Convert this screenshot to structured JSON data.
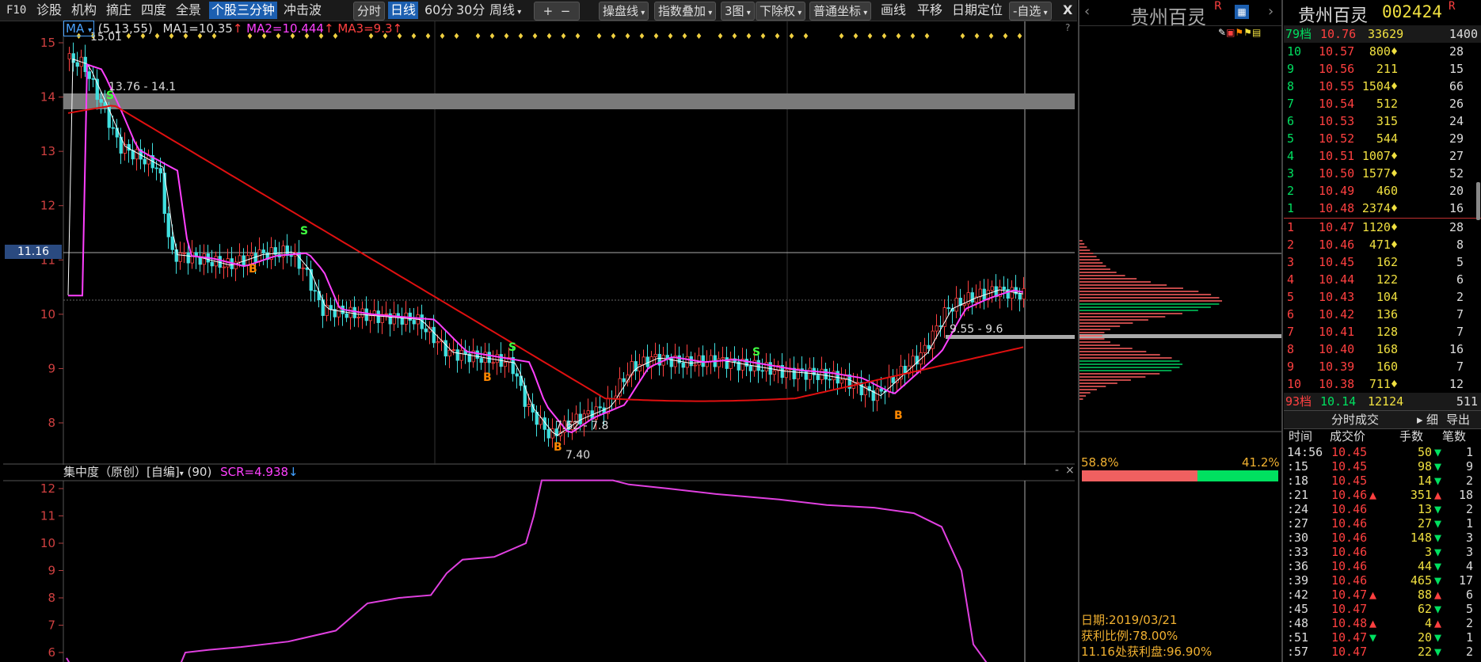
{
  "toolbar": {
    "items": [
      "F10",
      "诊股",
      "机构",
      "摘庄",
      "四度",
      "全景",
      "个股三分钟",
      "冲击波"
    ],
    "period_buttons": [
      "分时",
      "日线",
      "60分",
      "30分",
      "周线"
    ],
    "zoom_buttons": [
      "+",
      "−"
    ],
    "tools": [
      "操盘线",
      "指数叠加",
      "3图",
      "下除权",
      "普通坐标",
      "画线",
      "平移",
      "日期定位",
      "自选"
    ],
    "close_glyph": "X"
  },
  "main_chart": {
    "indicator_selector": "MA",
    "ma_params": "(5,13,55)",
    "ma1": "MA1=10.35",
    "ma2": "MA2=10.444",
    "ma3": "MA3=9.3",
    "price_axis": [
      "15",
      "14",
      "13",
      "12",
      "11",
      "10",
      "9",
      "8"
    ],
    "crosshair_price": "11.16",
    "annotations": {
      "high": "15.01",
      "zone1": "13.76 - 14.1",
      "zone2": "9.55 - 9.6",
      "zone3": "7.62 - 7.8",
      "low": "7.40"
    },
    "signal_labels": {
      "buy": "B",
      "sell": "S"
    },
    "help": "?"
  },
  "indicator_chart": {
    "title": "集中度（原创）[自编]",
    "param": "(90)",
    "value": "SCR=4.938",
    "axis": [
      "12",
      "11",
      "10",
      "9",
      "8",
      "7",
      "6"
    ],
    "minimize": "-",
    "close": "×"
  },
  "chip_panel": {
    "stock_name": "贵州百灵",
    "r_mark": "R",
    "profit_left": "58.8%",
    "profit_right": "41.2%",
    "date": "日期:2019/03/21",
    "profit_ratio": "获利比例:78.00%",
    "profit_at": "11.16处获利盘:96.90%"
  },
  "quote_panel": {
    "stock_name": "贵州百灵",
    "stock_code": "002424",
    "r_mark": "R",
    "ask_header": {
      "label": "79档",
      "price": "10.76",
      "vol": "33629",
      "count": "1400"
    },
    "asks": [
      {
        "lvl": "10",
        "price": "10.57",
        "vol": "800",
        "mark": "♦",
        "cnt": "28"
      },
      {
        "lvl": "9",
        "price": "10.56",
        "vol": "211",
        "mark": "",
        "cnt": "15"
      },
      {
        "lvl": "8",
        "price": "10.55",
        "vol": "1504",
        "mark": "♦",
        "cnt": "66"
      },
      {
        "lvl": "7",
        "price": "10.54",
        "vol": "512",
        "mark": "",
        "cnt": "26"
      },
      {
        "lvl": "6",
        "price": "10.53",
        "vol": "315",
        "mark": "",
        "cnt": "24"
      },
      {
        "lvl": "5",
        "price": "10.52",
        "vol": "544",
        "mark": "",
        "cnt": "29"
      },
      {
        "lvl": "4",
        "price": "10.51",
        "vol": "1007",
        "mark": "♦",
        "cnt": "27"
      },
      {
        "lvl": "3",
        "price": "10.50",
        "vol": "1577",
        "mark": "♦",
        "cnt": "52"
      },
      {
        "lvl": "2",
        "price": "10.49",
        "vol": "460",
        "mark": "",
        "cnt": "20"
      },
      {
        "lvl": "1",
        "price": "10.48",
        "vol": "2374",
        "mark": "♦",
        "cnt": "16"
      }
    ],
    "bids": [
      {
        "lvl": "1",
        "price": "10.47",
        "vol": "1120",
        "mark": "♦",
        "cnt": "28"
      },
      {
        "lvl": "2",
        "price": "10.46",
        "vol": "471",
        "mark": "♦",
        "cnt": "8"
      },
      {
        "lvl": "3",
        "price": "10.45",
        "vol": "162",
        "mark": "",
        "cnt": "5"
      },
      {
        "lvl": "4",
        "price": "10.44",
        "vol": "122",
        "mark": "",
        "cnt": "6"
      },
      {
        "lvl": "5",
        "price": "10.43",
        "vol": "104",
        "mark": "",
        "cnt": "2"
      },
      {
        "lvl": "6",
        "price": "10.42",
        "vol": "136",
        "mark": "",
        "cnt": "7"
      },
      {
        "lvl": "7",
        "price": "10.41",
        "vol": "128",
        "mark": "",
        "cnt": "7"
      },
      {
        "lvl": "8",
        "price": "10.40",
        "vol": "168",
        "mark": "",
        "cnt": "16"
      },
      {
        "lvl": "9",
        "price": "10.39",
        "vol": "160",
        "mark": "",
        "cnt": "7"
      },
      {
        "lvl": "10",
        "price": "10.38",
        "vol": "711",
        "mark": "♦",
        "cnt": "12"
      }
    ],
    "bid_footer": {
      "label": "93档",
      "price": "10.14",
      "vol": "12124",
      "count": "511"
    },
    "trades_title": "分时成交",
    "trades_tabs": [
      "细",
      "导出"
    ],
    "trades_headers": [
      "时间",
      "成交价",
      "手数",
      "笔数"
    ],
    "trades": [
      {
        "t": "14:56",
        "p": "10.45",
        "pd": "",
        "v": "50",
        "d": "▼",
        "n": "1"
      },
      {
        "t": ":15",
        "p": "10.45",
        "pd": "",
        "v": "98",
        "d": "▼",
        "n": "9"
      },
      {
        "t": ":18",
        "p": "10.45",
        "pd": "",
        "v": "14",
        "d": "▼",
        "n": "2"
      },
      {
        "t": ":21",
        "p": "10.46",
        "pd": "▲",
        "v": "351",
        "d": "▲",
        "n": "18"
      },
      {
        "t": ":24",
        "p": "10.46",
        "pd": "",
        "v": "13",
        "d": "▼",
        "n": "2"
      },
      {
        "t": ":27",
        "p": "10.46",
        "pd": "",
        "v": "27",
        "d": "▼",
        "n": "1"
      },
      {
        "t": ":30",
        "p": "10.46",
        "pd": "",
        "v": "148",
        "d": "▼",
        "n": "3"
      },
      {
        "t": ":33",
        "p": "10.46",
        "pd": "",
        "v": "3",
        "d": "▼",
        "n": "3"
      },
      {
        "t": ":36",
        "p": "10.46",
        "pd": "",
        "v": "44",
        "d": "▼",
        "n": "4"
      },
      {
        "t": ":39",
        "p": "10.46",
        "pd": "",
        "v": "465",
        "d": "▼",
        "n": "17"
      },
      {
        "t": ":42",
        "p": "10.47",
        "pd": "▲",
        "v": "88",
        "d": "▲",
        "n": "6"
      },
      {
        "t": ":45",
        "p": "10.47",
        "pd": "",
        "v": "62",
        "d": "▼",
        "n": "5"
      },
      {
        "t": ":48",
        "p": "10.48",
        "pd": "▲",
        "v": "4",
        "d": "▲",
        "n": "2"
      },
      {
        "t": ":51",
        "p": "10.47",
        "pd": "▼",
        "v": "20",
        "d": "▼",
        "n": "1"
      },
      {
        "t": ":57",
        "p": "10.47",
        "pd": "",
        "v": "22",
        "d": "▼",
        "n": "2"
      }
    ]
  }
}
